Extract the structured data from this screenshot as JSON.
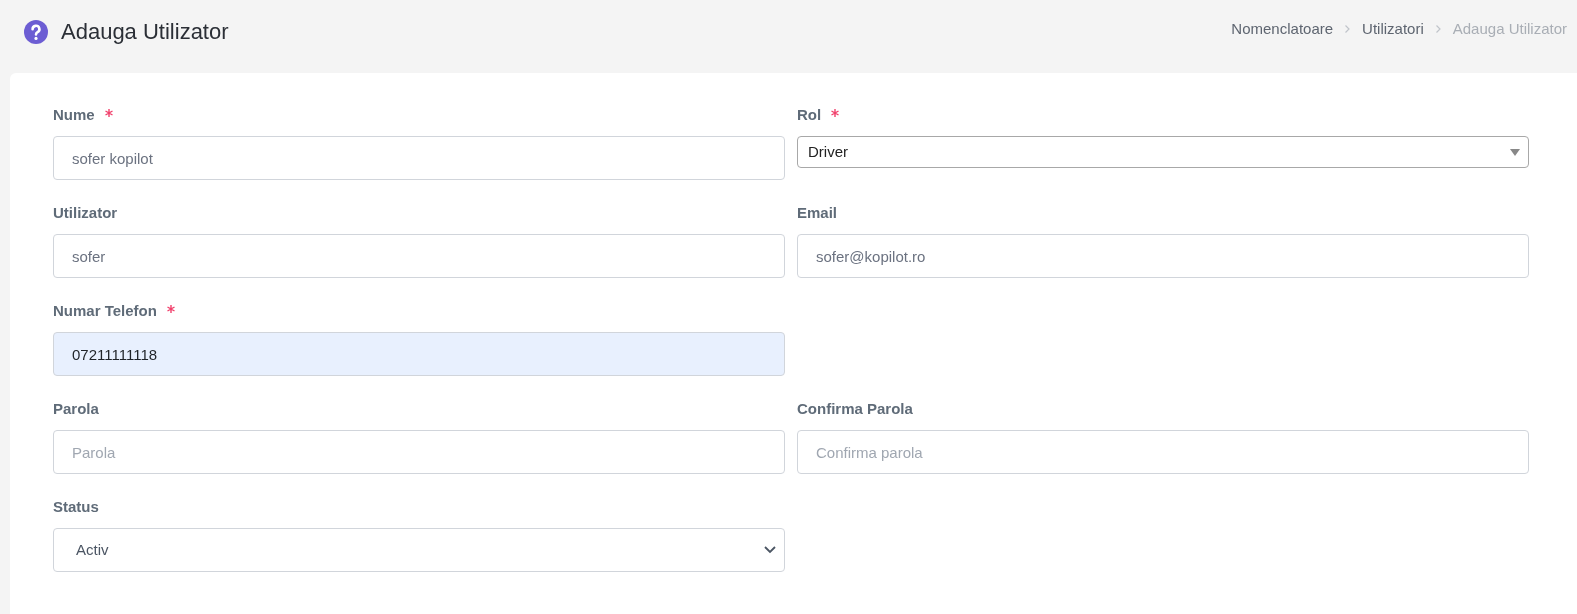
{
  "page": {
    "title": "Adauga Utilizator"
  },
  "breadcrumb": [
    {
      "label": "Nomenclatoare",
      "current": false
    },
    {
      "label": "Utilizatori",
      "current": false
    },
    {
      "label": "Adauga Utilizator",
      "current": true
    }
  ],
  "form": {
    "rows": [
      {
        "fields": [
          {
            "label": "Nume",
            "required": true,
            "kind": "text",
            "value": "sofer kopilot",
            "autofilled": false
          },
          {
            "label": "Rol",
            "required": true,
            "kind": "dropdown",
            "value": "Driver",
            "autofilled": false
          }
        ]
      },
      {
        "fields": [
          {
            "label": "Utilizator",
            "required": false,
            "kind": "text",
            "value": "sofer",
            "autofilled": false
          },
          {
            "label": "Email",
            "required": false,
            "kind": "text",
            "value": "sofer@kopilot.ro",
            "autofilled": false
          }
        ]
      },
      {
        "fields": [
          {
            "label": "Numar Telefon",
            "required": true,
            "kind": "text",
            "value": "07211111118",
            "autofilled": true
          }
        ]
      },
      {
        "fields": [
          {
            "label": "Parola",
            "required": false,
            "kind": "text",
            "placeholder": "Parola",
            "autofilled": false
          },
          {
            "label": "Confirma Parola",
            "required": false,
            "kind": "text",
            "placeholder": "Confirma parola",
            "autofilled": false
          }
        ]
      },
      {
        "fields": [
          {
            "label": "Status",
            "required": false,
            "kind": "select",
            "value": "Activ",
            "autofilled": false
          }
        ]
      }
    ]
  }
}
